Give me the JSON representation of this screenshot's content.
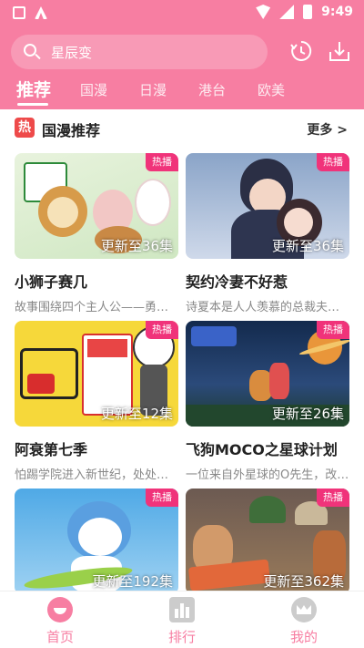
{
  "status_bar": {
    "time": "9:49"
  },
  "search": {
    "text": "星辰变"
  },
  "header_icons": [
    "history-icon",
    "download-icon"
  ],
  "tabs": [
    {
      "label": "推荐",
      "active": true
    },
    {
      "label": "国漫"
    },
    {
      "label": "日漫"
    },
    {
      "label": "港台"
    },
    {
      "label": "欧美"
    }
  ],
  "section": {
    "badge": "热",
    "title": "国漫推荐",
    "more": "更多 >"
  },
  "cards": [
    {
      "tag": "热播",
      "update": "更新至36集",
      "title": "小狮子赛几",
      "desc": "故事围绕四个主人公——勇敢…"
    },
    {
      "tag": "热播",
      "update": "更新至36集",
      "title": "契约冷妻不好惹",
      "desc": "诗夏本是人人羡慕的总裁夫人…"
    },
    {
      "tag": "热播",
      "update": "更新至12集",
      "title": "阿衰第七季",
      "desc": "怕踢学院进入新世纪，处处充…"
    },
    {
      "tag": "热播",
      "update": "更新至26集",
      "title": "飞狗MOCO之星球计划",
      "desc": "一位来自外星球的O先生，改…"
    },
    {
      "tag": "热播",
      "update": "更新至192集",
      "title": "",
      "desc": ""
    },
    {
      "tag": "热播",
      "update": "更新至362集",
      "title": "",
      "desc": ""
    }
  ],
  "bottom_nav": [
    {
      "label": "首页",
      "active": true
    },
    {
      "label": "排行"
    },
    {
      "label": "我的"
    }
  ],
  "colors": {
    "brand_pink": "#f77ea2",
    "tag_pink": "#f0337a",
    "hot_red": "#ee4a4a"
  }
}
